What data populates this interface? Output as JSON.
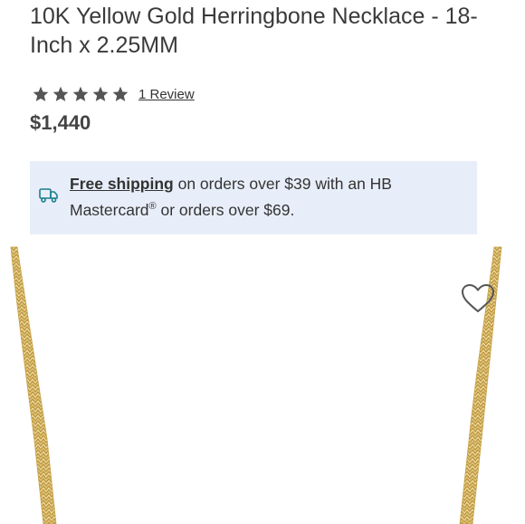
{
  "product": {
    "title": "10K Yellow Gold Herringbone Necklace - 18-Inch x 2.25MM",
    "rating": 5,
    "rating_max": 5,
    "review_link": "1 Review",
    "price": "$1,440"
  },
  "shipping": {
    "icon": "truck-icon",
    "link_text": "Free shipping",
    "text_1": " on orders over $39 with an HB Mastercard",
    "reg_mark": "®",
    "text_2": " or orders over $69."
  },
  "gallery": {
    "favorite_icon": "heart-outline-icon"
  },
  "colors": {
    "banner_bg": "#e8eef9",
    "icon_teal": "#1a7f8e",
    "gold": "#d4b25a",
    "star": "#555555"
  }
}
